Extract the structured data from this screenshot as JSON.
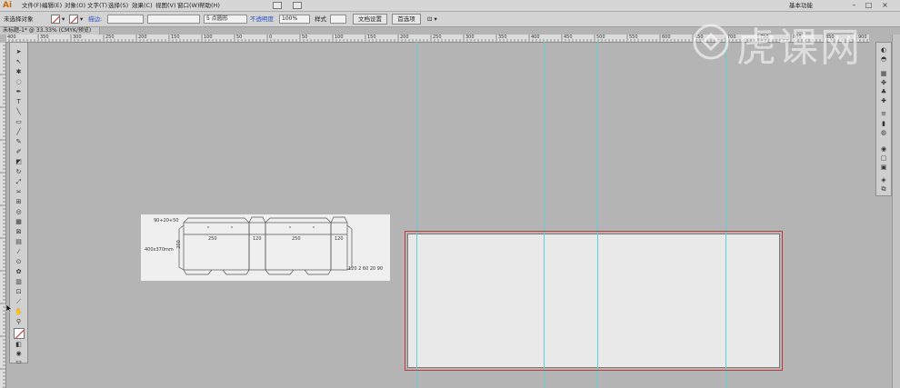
{
  "app": {
    "logo": "Ai"
  },
  "menu": [
    "文件(F)",
    "编辑(E)",
    "对象(O)",
    "文字(T)",
    "选择(S)",
    "效果(C)",
    "视图(V)",
    "窗口(W)",
    "帮助(H)"
  ],
  "workspace": "基本功能",
  "window_controls": [
    "–",
    "□",
    "×"
  ],
  "controlbar": {
    "selection_status": "未选择对象",
    "stroke_label": "描边:",
    "stroke_profile": "5 点圆形",
    "opacity_label": "不透明度",
    "opacity_value": "100%",
    "style_label": "样式",
    "doc_setup_button": "文档设置",
    "preferences_button": "首选项"
  },
  "document_tab": "未标题-1* @ 33.33% (CMYK/预览)",
  "ruler_top_labels": [
    "400",
    "350",
    "300",
    "250",
    "200",
    "150",
    "100",
    "50",
    "0",
    "50",
    "100",
    "150",
    "200",
    "250",
    "300",
    "350",
    "400",
    "450",
    "500",
    "550",
    "600",
    "650",
    "700",
    "750",
    "800",
    "850",
    "900",
    "950"
  ],
  "reference_image": {
    "dims_top": "90+20+50",
    "size_note": "400x370mm",
    "side_label": "200",
    "panel_labels": [
      "250",
      "120",
      "250",
      "120"
    ],
    "bottom_dims": "120  2  60  20  90"
  },
  "watermark": "虎课网",
  "colors": {
    "canvas": "#b4b4b4",
    "guide": "#5fd0d6",
    "artboard_border": "#c23a3a",
    "artboard_fill": "#e9e9e9"
  }
}
